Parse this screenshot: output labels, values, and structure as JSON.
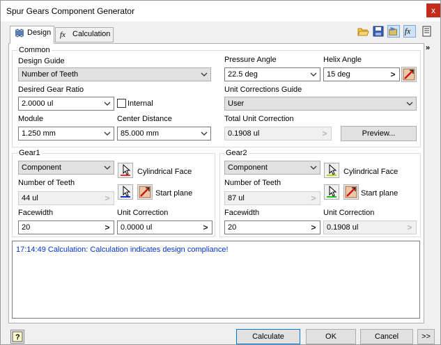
{
  "window": {
    "title": "Spur Gears Component Generator",
    "close_glyph": "x"
  },
  "tabs": [
    {
      "label": "Design",
      "icon": "gear-icon",
      "active": true
    },
    {
      "label": "Calculation",
      "icon": "fx-icon",
      "active": false
    }
  ],
  "toolbar": {
    "icons": [
      "open-folder-icon",
      "save-icon",
      "settings-icon",
      "fx-icon",
      "report-icon"
    ]
  },
  "expand_glyph": "»",
  "common": {
    "group_label": "Common",
    "design_guide": {
      "label": "Design Guide",
      "value": "Number of Teeth"
    },
    "gear_ratio": {
      "label": "Desired Gear Ratio",
      "value": "2.0000 ul",
      "internal_label": "Internal",
      "internal_checked": false
    },
    "module": {
      "label": "Module",
      "value": "1.250 mm"
    },
    "center_distance": {
      "label": "Center Distance",
      "value": "85.000 mm"
    },
    "pressure_angle": {
      "label": "Pressure Angle",
      "value": "22.5 deg"
    },
    "helix_angle": {
      "label": "Helix Angle",
      "value": "15 deg"
    },
    "unit_corrections_guide": {
      "label": "Unit Corrections Guide",
      "value": "User"
    },
    "total_unit_correction": {
      "label": "Total Unit Correction",
      "value": "0.1908 ul"
    },
    "preview_button": "Preview..."
  },
  "gear1": {
    "group_label": "Gear1",
    "type": "Component",
    "cylindrical_face": "Cylindrical Face",
    "start_plane": "Start plane",
    "teeth_label": "Number of Teeth",
    "teeth_value": "44 ul",
    "facewidth_label": "Facewidth",
    "facewidth_value": "20",
    "unit_correction_label": "Unit Correction",
    "unit_correction_value": "0.0000 ul",
    "face_color": "#e83030",
    "plane_color": "#1030d0"
  },
  "gear2": {
    "group_label": "Gear2",
    "type": "Component",
    "cylindrical_face": "Cylindrical Face",
    "start_plane": "Start plane",
    "teeth_label": "Number of Teeth",
    "teeth_value": "87 ul",
    "facewidth_label": "Facewidth",
    "facewidth_value": "20",
    "unit_correction_label": "Unit Correction",
    "unit_correction_value": "0.1908 ul",
    "face_color": "#b8d800",
    "plane_color": "#20c020"
  },
  "message": "17:14:49 Calculation: Calculation indicates design compliance!",
  "footer": {
    "help_glyph": "?",
    "calculate": "Calculate",
    "ok": "OK",
    "cancel": "Cancel",
    "more": ">>"
  }
}
